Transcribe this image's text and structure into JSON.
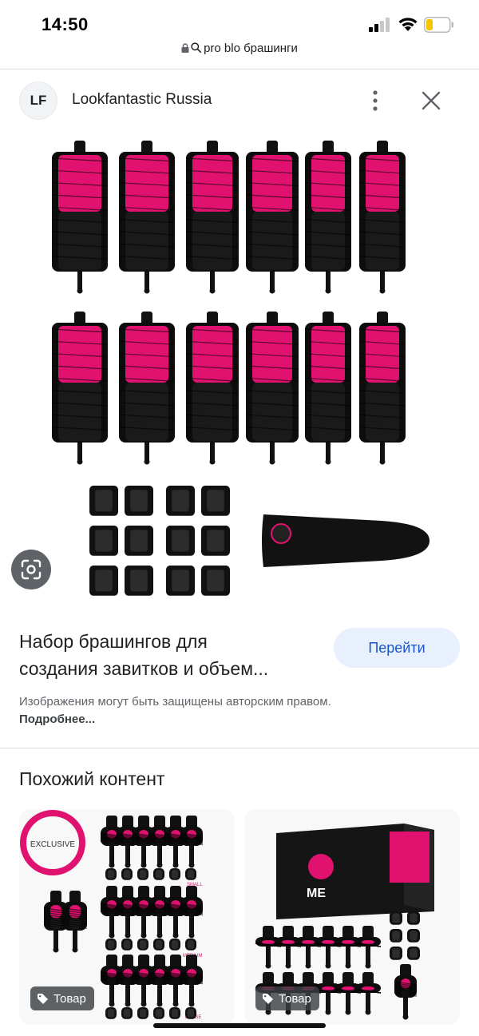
{
  "status_bar": {
    "time": "14:50",
    "signal_bars": 2,
    "battery_level": 0.2,
    "battery_color": "#f5c400"
  },
  "url_bar": {
    "url": "pro blo брашинги"
  },
  "source": {
    "logo_text": "LF",
    "name": "Lookfantastic Russia"
  },
  "result": {
    "title_line1": "Набор брашингов для",
    "title_line2": "создания завитков и объем...",
    "visit_label": "Перейти",
    "copyright_text": "Изображения могут быть защищены авторским правом.",
    "copyright_more": "Подробнее..."
  },
  "related": {
    "heading": "Похожий контент",
    "cards": [
      {
        "chip_label": "Товар",
        "badge_text": "EXCLUSIVE",
        "size_labels": [
          "SMALL",
          "MEDIUM",
          "LARGE"
        ]
      },
      {
        "chip_label": "Товар",
        "box_brand": "ME"
      }
    ]
  },
  "colors": {
    "accent_pink": "#e0116f",
    "link_blue": "#1a56c8",
    "button_bg": "#e8f0fe"
  }
}
